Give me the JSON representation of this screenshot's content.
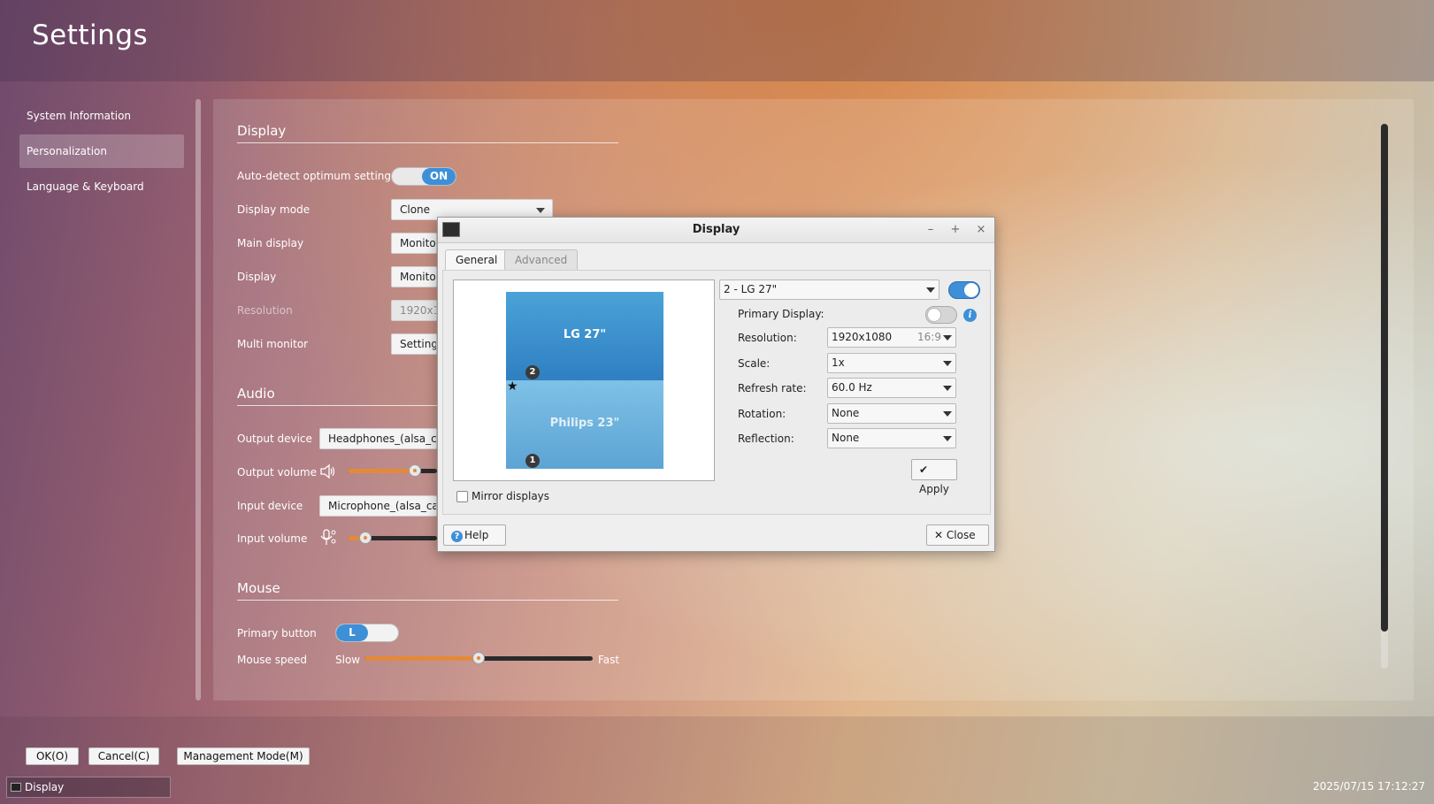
{
  "app": {
    "title": "Settings"
  },
  "sidebar": {
    "items": [
      {
        "label": "System Information"
      },
      {
        "label": "Personalization"
      },
      {
        "label": "Language & Keyboard"
      }
    ]
  },
  "display_section": {
    "title": "Display",
    "auto_detect": {
      "label": "Auto-detect optimum settings",
      "state": "ON"
    },
    "display_mode": {
      "label": "Display mode",
      "value": "Clone"
    },
    "main_display": {
      "label": "Main display",
      "value": "Monitor"
    },
    "display": {
      "label": "Display",
      "value": "Monitor"
    },
    "resolution": {
      "label": "Resolution",
      "value": "1920x1"
    },
    "multi_monitor": {
      "label": "Multi monitor",
      "value": "Setting"
    }
  },
  "audio_section": {
    "title": "Audio",
    "output_device": {
      "label": "Output device",
      "value": "Headphones_(alsa_car"
    },
    "output_volume": {
      "label": "Output volume",
      "level_percent": 75
    },
    "input_device": {
      "label": "Input device",
      "value": "Microphone_(alsa_card"
    },
    "input_volume": {
      "label": "Input volume",
      "level_percent": 20
    }
  },
  "mouse_section": {
    "title": "Mouse",
    "primary_button": {
      "label": "Primary button",
      "value": "L"
    },
    "mouse_speed": {
      "label": "Mouse speed",
      "min_label": "Slow",
      "max_label": "Fast",
      "level_percent": 50
    }
  },
  "footer": {
    "ok_label": "OK(O)",
    "cancel_label": "Cancel(C)",
    "management_label": "Management Mode(M)"
  },
  "taskbar": {
    "item_label": "Display",
    "clock": "2025/07/15 17:12:27"
  },
  "dialog": {
    "title": "Display",
    "tabs": [
      {
        "label": "General"
      },
      {
        "label": "Advanced"
      }
    ],
    "monitors": [
      {
        "name": "LG 27\"",
        "number": "2"
      },
      {
        "name": "Philips 23\"",
        "number": "1"
      }
    ],
    "mirror_label": "Mirror displays",
    "selected_monitor": "2 - LG 27\"",
    "primary_display_label": "Primary Display:",
    "fields": {
      "resolution": {
        "label": "Resolution:",
        "value": "1920x1080",
        "aspect": "16:9"
      },
      "scale": {
        "label": "Scale:",
        "value": "1x"
      },
      "refresh_rate": {
        "label": "Refresh rate:",
        "value": "60.0 Hz"
      },
      "rotation": {
        "label": "Rotation:",
        "value": "None"
      },
      "reflection": {
        "label": "Reflection:",
        "value": "None"
      }
    },
    "apply_label": "Apply",
    "help_label": "Help",
    "close_label": "Close"
  },
  "colors": {
    "accent": "#3d8fd8",
    "slider_fill": "#e38a3a"
  }
}
